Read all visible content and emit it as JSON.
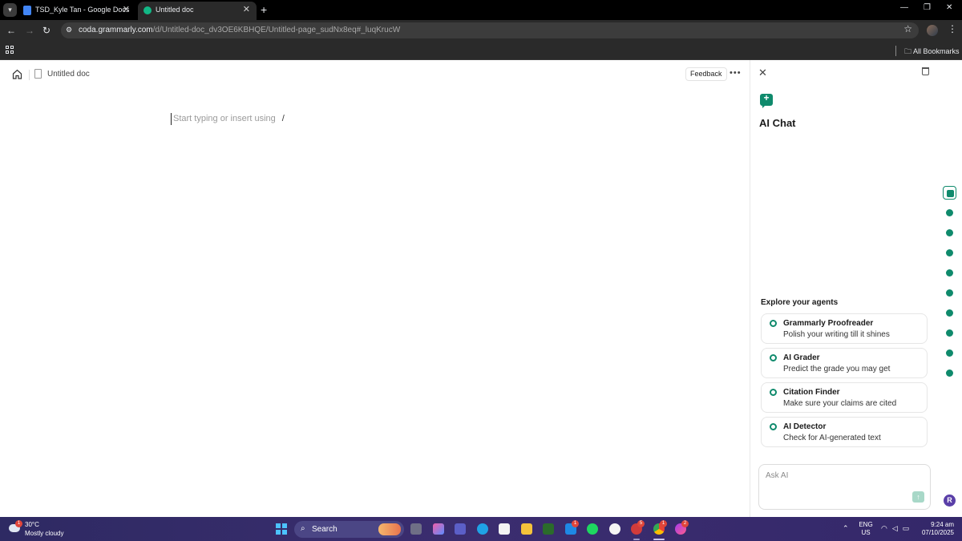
{
  "browser": {
    "tabs": [
      {
        "title": "TSD_Kyle Tan - Google Docs",
        "active": false
      },
      {
        "title": "Untitled doc",
        "active": true
      }
    ],
    "new_tab_label": "+",
    "url_host": "coda.grammarly.com",
    "url_path": "/d/Untitled-doc_dv3OE6KBHQE/Untitled-page_sudNx8eq#_luqKrucW",
    "bookmarks_label": "All Bookmarks"
  },
  "doc": {
    "title": "Untitled doc",
    "feedback_label": "Feedback",
    "more_label": "•••",
    "placeholder": "Start typing or insert using",
    "slash": "/"
  },
  "panel": {
    "title": "AI Chat",
    "explore_title": "Explore your agents",
    "agents": [
      {
        "name": "Grammarly Proofreader",
        "desc": "Polish your writing till it shines"
      },
      {
        "name": "AI Grader",
        "desc": "Predict the grade you may get"
      },
      {
        "name": "Citation Finder",
        "desc": "Make sure your claims are cited"
      },
      {
        "name": "AI Detector",
        "desc": "Check for AI-generated text"
      }
    ],
    "ask_placeholder": "Ask AI"
  },
  "rail": {
    "icons": [
      "ai-chat-icon",
      "grammarly-icon",
      "grader-icon",
      "citation-icon",
      "detector-icon",
      "reader-icon",
      "paraphrase-icon",
      "quote-icon",
      "check-icon",
      "expert-icon"
    ],
    "avatar_initial": "R"
  },
  "taskbar": {
    "temperature": "30°C",
    "condition": "Mostly cloudy",
    "weather_badge": "1",
    "search_label": "Search",
    "badges": {
      "mail": "1",
      "opera": "5",
      "chrome": "1",
      "messenger": "2"
    },
    "lang_1": "ENG",
    "lang_2": "US",
    "time": "9:24 am",
    "date": "07/10/2025"
  },
  "colors": {
    "accent": "#0f8a6c",
    "taskbar": "#2e2a63"
  }
}
